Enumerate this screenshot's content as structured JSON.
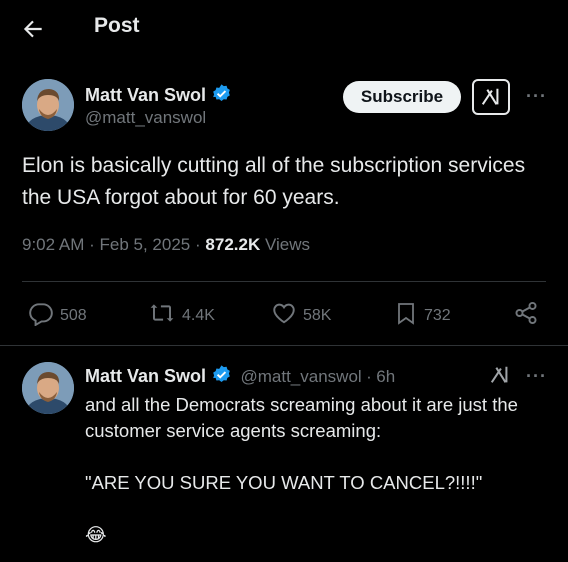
{
  "header": {
    "title": "Post"
  },
  "post": {
    "author_name": "Matt Van Swol",
    "author_handle": "@matt_vanswol",
    "subscribe_label": "Subscribe",
    "more_label": "···",
    "text": "Elon is basically cutting all of the subscription services the USA forgot about for 60 years.",
    "time": "9:02 AM",
    "date": "Feb 5, 2025",
    "views_count": "872.2K",
    "views_label": "Views",
    "separator": "·"
  },
  "actions": {
    "replies": "508",
    "reposts": "4.4K",
    "likes": "58K",
    "bookmarks": "732"
  },
  "reply": {
    "author_name": "Matt Van Swol",
    "author_handle": "@matt_vanswol",
    "separator": "·",
    "time_ago": "6h",
    "more_label": "···",
    "text": "and all the Democrats screaming about it are just the customer service agents screaming:\n\n\"ARE YOU SURE YOU WANT TO CANCEL?!!!!\"\n\n😂"
  },
  "colors": {
    "background": "#000000",
    "verified": "#1d9bf0",
    "muted": "#71767b",
    "text": "#e7e9ea"
  },
  "icons": [
    "back-arrow-icon",
    "verified-badge-icon",
    "grok-icon",
    "more-icon",
    "reply-icon",
    "repost-icon",
    "like-icon",
    "bookmark-icon",
    "share-icon"
  ]
}
